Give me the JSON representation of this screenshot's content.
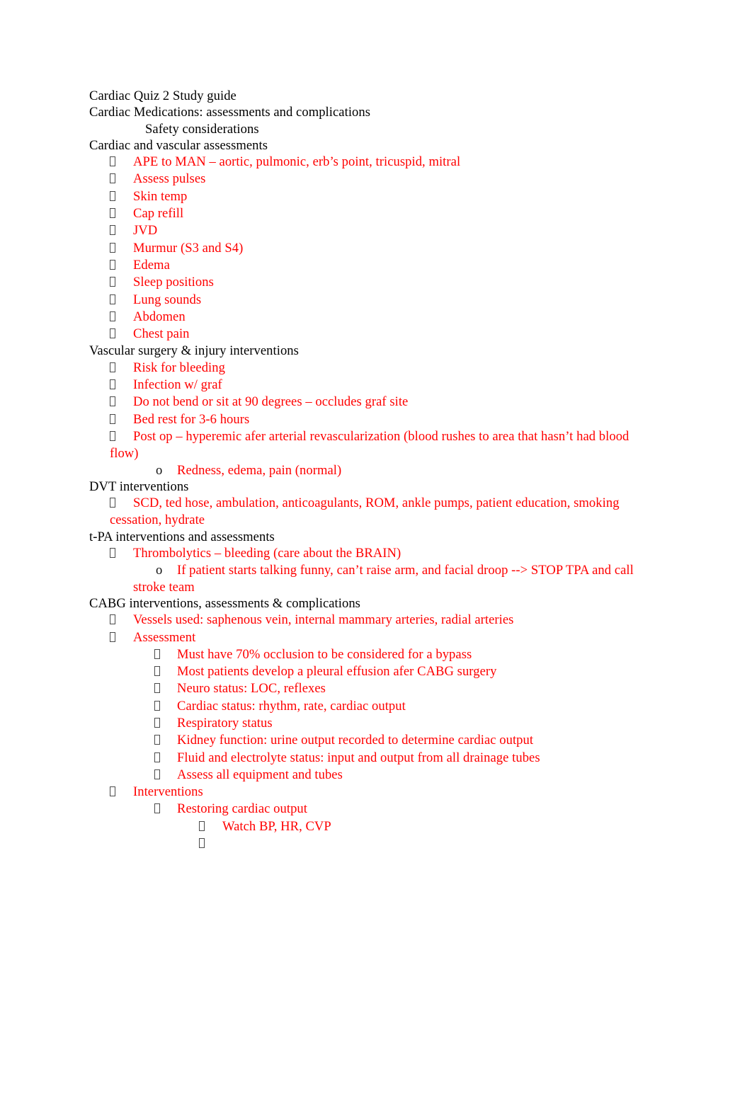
{
  "document": {
    "title": "Cardiac Quiz 2 Study guide",
    "text_color_body": "#000000",
    "text_color_highlight": "#ff0000",
    "bullet_marker_level1": "tofu-box",
    "bullet_marker_level2": "o",
    "bullet_marker_level3": "tofu-box",
    "bullet_marker_level4": "tofu-box"
  },
  "lines": {
    "l1": "Cardiac Quiz 2 Study guide",
    "l2": "Cardiac Medications: assessments and complications",
    "l3": "Safety considerations",
    "l4": "Cardiac and vascular assessments",
    "l5": "APE to MAN – aortic, pulmonic, erb’s point, tricuspid, mitral",
    "l6": "Assess pulses",
    "l7": "Skin temp",
    "l8": "Cap refill",
    "l9": "JVD",
    "l10": "Murmur (S3 and S4)",
    "l11": "Edema",
    "l12": "Sleep positions",
    "l13": "Lung sounds",
    "l14": "Abdomen",
    "l15": "Chest pain",
    "l16": "Vascular surgery & injury interventions",
    "l17": "Risk for bleeding",
    "l18": "Infection w/ graf",
    "l19": "Do not bend or sit at 90 degrees – occludes graf site",
    "l20": "Bed rest for 3-6 hours",
    "l21": "Post op – hyperemic afer arterial revascularization (blood rushes to area that hasn’t had blood flow)",
    "l22": "Redness, edema, pain (normal)",
    "l23": "DVT interventions",
    "l24": "SCD, ted hose, ambulation, anticoagulants, ROM, ankle pumps, patient education, smoking cessation, hydrate",
    "l25": "t-PA interventions and assessments",
    "l26": "Thrombolytics – bleeding (care about the BRAIN)",
    "l27": "If patient starts talking funny, can’t raise arm, and facial droop --> STOP TPA and call stroke team",
    "l28": "CABG interventions, assessments & complications",
    "l29": "Vessels used: saphenous vein, internal mammary arteries, radial arteries",
    "l30": "Assessment",
    "l31": "Must have 70% occlusion to be considered for a bypass",
    "l32": "Most patients develop a pleural effusion afer CABG surgery",
    "l33": "Neuro status: LOC, reflexes",
    "l34": "Cardiac status: rhythm, rate, cardiac output",
    "l35": "Respiratory status",
    "l36": "Kidney function: urine output recorded to determine cardiac output",
    "l37": "Fluid and electrolyte status: input and output from all drainage tubes",
    "l38": "Assess all equipment and tubes",
    "l39": "Interventions",
    "l40": "Restoring cardiac output",
    "l41": "Watch BP, HR, CVP",
    "l42": ""
  },
  "markers": {
    "o": "o"
  }
}
